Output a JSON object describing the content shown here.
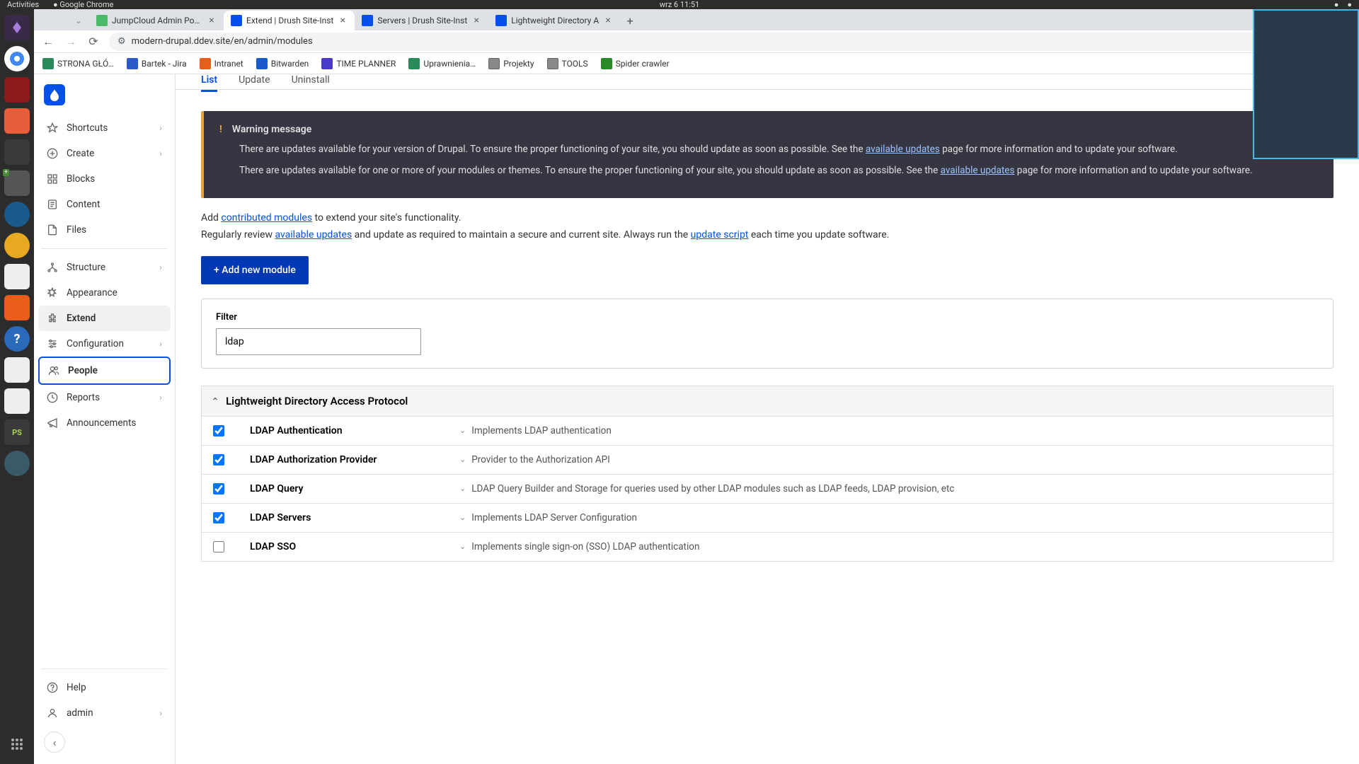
{
  "os": {
    "activities": "Activities",
    "app": "Google Chrome",
    "clock": "wrz 6  11:51"
  },
  "tabs": [
    {
      "title": "JumpCloud Admin Porta",
      "active": false
    },
    {
      "title": "Extend | Drush Site-Inst",
      "active": true
    },
    {
      "title": "Servers | Drush Site-Inst",
      "active": false
    },
    {
      "title": "Lightweight Directory A",
      "active": false
    }
  ],
  "url": "modern-drupal.ddev.site/en/admin/modules",
  "bookmarks": [
    {
      "label": "STRONA GŁÓ…"
    },
    {
      "label": "Bartek - Jira"
    },
    {
      "label": "Intranet"
    },
    {
      "label": "Bitwarden"
    },
    {
      "label": "TIME PLANNER"
    },
    {
      "label": "Uprawnienia…"
    },
    {
      "label": "Projekty"
    },
    {
      "label": "TOOLS"
    },
    {
      "label": "Spider crawler"
    }
  ],
  "sidebar": {
    "items": [
      {
        "label": "Shortcuts",
        "chevron": true
      },
      {
        "label": "Create",
        "chevron": true
      },
      {
        "label": "Blocks"
      },
      {
        "label": "Content"
      },
      {
        "label": "Files"
      },
      {
        "label": "Structure",
        "chevron": true
      },
      {
        "label": "Appearance"
      },
      {
        "label": "Extend",
        "active": true
      },
      {
        "label": "Configuration",
        "chevron": true
      },
      {
        "label": "People",
        "highlighted": true
      },
      {
        "label": "Reports",
        "chevron": true
      },
      {
        "label": "Announcements"
      }
    ],
    "bottom": [
      {
        "label": "Help"
      },
      {
        "label": "admin",
        "chevron": true
      }
    ]
  },
  "content_tabs": [
    {
      "label": "List",
      "active": true
    },
    {
      "label": "Update"
    },
    {
      "label": "Uninstall"
    }
  ],
  "warning": {
    "title": "Warning message",
    "p1a": "There are updates available for your version of Drupal. To ensure the proper functioning of your site, you should update as soon as possible. See the ",
    "p1link": "available updates",
    "p1b": " page for more information and to update your software.",
    "p2a": "There are updates available for one or more of your modules or themes. To ensure the proper functioning of your site, you should update as soon as possible. See the ",
    "p2link": "available updates",
    "p2b": " page for more information and to update your software."
  },
  "intro": {
    "l1a": "Add ",
    "l1link": "contributed modules",
    "l1b": " to extend your site's functionality.",
    "l2a": "Regularly review ",
    "l2link1": "available updates",
    "l2b": " and update as required to maintain a secure and current site. Always run the ",
    "l2link2": "update script",
    "l2c": " each time you update software."
  },
  "add_button": "+ Add new module",
  "filter": {
    "label": "Filter",
    "value": "ldap"
  },
  "group": {
    "title": "Lightweight Directory Access Protocol",
    "modules": [
      {
        "name": "LDAP Authentication",
        "desc": "Implements LDAP authentication",
        "checked": true
      },
      {
        "name": "LDAP Authorization Provider",
        "desc": "Provider to the Authorization API",
        "checked": true
      },
      {
        "name": "LDAP Query",
        "desc": "LDAP Query Builder and Storage for queries used by other LDAP modules such as LDAP feeds, LDAP provision, etc",
        "checked": true
      },
      {
        "name": "LDAP Servers",
        "desc": "Implements LDAP Server Configuration",
        "checked": true
      },
      {
        "name": "LDAP SSO",
        "desc": "Implements single sign-on (SSO) LDAP authentication",
        "checked": false
      }
    ]
  }
}
